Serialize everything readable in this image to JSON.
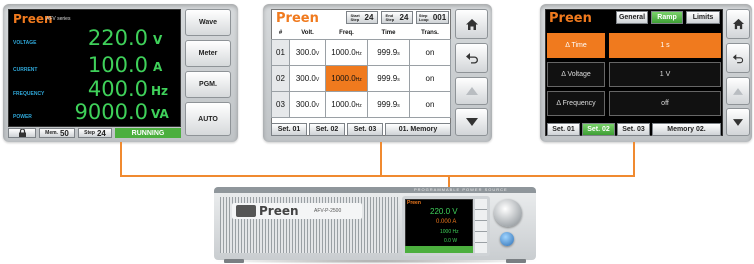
{
  "panel_measure": {
    "brand": "Preen",
    "series": "AFV series",
    "rows": [
      {
        "label": "VOLTAGE",
        "value": "220.0",
        "unit": "V"
      },
      {
        "label": "CURRENT",
        "value": "100.0",
        "unit": "A"
      },
      {
        "label": "FREQUENCY",
        "value": "400.0",
        "unit": "Hz"
      },
      {
        "label": "POWER",
        "value": "9000.0",
        "unit": "VA"
      }
    ],
    "side_buttons": [
      "Wave",
      "Meter",
      "PGM.",
      "AUTO"
    ],
    "footer": {
      "mem_label": "Mem.",
      "mem_value": "50",
      "step_label": "Step",
      "step_value": "24",
      "status": "RUNNING"
    }
  },
  "panel_sequence": {
    "brand": "Preen",
    "start": {
      "label": "Start Step",
      "value": "24"
    },
    "end": {
      "label": "End Step",
      "value": "24"
    },
    "loop": {
      "label": "Step Loop",
      "value": "001"
    },
    "columns": [
      "#",
      "Volt.",
      "Freq.",
      "Time",
      "Trans."
    ],
    "rows": [
      {
        "num": "01",
        "volt": "300.0",
        "volt_unit": "V",
        "freq": "1000.0",
        "freq_unit": "Hz",
        "time": "999.9",
        "time_unit": "s",
        "trans": "on"
      },
      {
        "num": "02",
        "volt": "300.0",
        "volt_unit": "V",
        "freq": "1000.0",
        "freq_unit": "Hz",
        "time": "999.9",
        "time_unit": "s",
        "trans": "on"
      },
      {
        "num": "03",
        "volt": "300.0",
        "volt_unit": "V",
        "freq": "1000.0",
        "freq_unit": "Hz",
        "time": "999.9",
        "time_unit": "s",
        "trans": "on"
      }
    ],
    "tabs": [
      "Set. 01",
      "Set. 02",
      "Set. 03"
    ],
    "memory": "01. Memory"
  },
  "panel_ramp": {
    "brand": "Preen",
    "tabs": [
      "General",
      "Ramp",
      "Limits"
    ],
    "active_tab": "Ramp",
    "rows": [
      {
        "label": "Δ Time",
        "value": "1 s"
      },
      {
        "label": "Δ Voltage",
        "value": "1 V"
      },
      {
        "label": "Δ Frequency",
        "value": "off"
      }
    ],
    "footer_tabs": [
      "Set. 01",
      "Set. 02",
      "Set. 03"
    ],
    "memory": "Memory 02."
  },
  "device": {
    "brand": "Preen",
    "model": "AFV-P-2500",
    "header_text": "PROGRAMMABLE POWER SOURCE",
    "screen": {
      "v": "220.0 V",
      "a": "0.000 A",
      "hz": "1000 Hz",
      "w": "0.0 W"
    }
  },
  "colors": {
    "brand": "#f07a1e",
    "reading": "#3fd15a",
    "label": "#2fa7d8",
    "running": "#4caf3e"
  }
}
